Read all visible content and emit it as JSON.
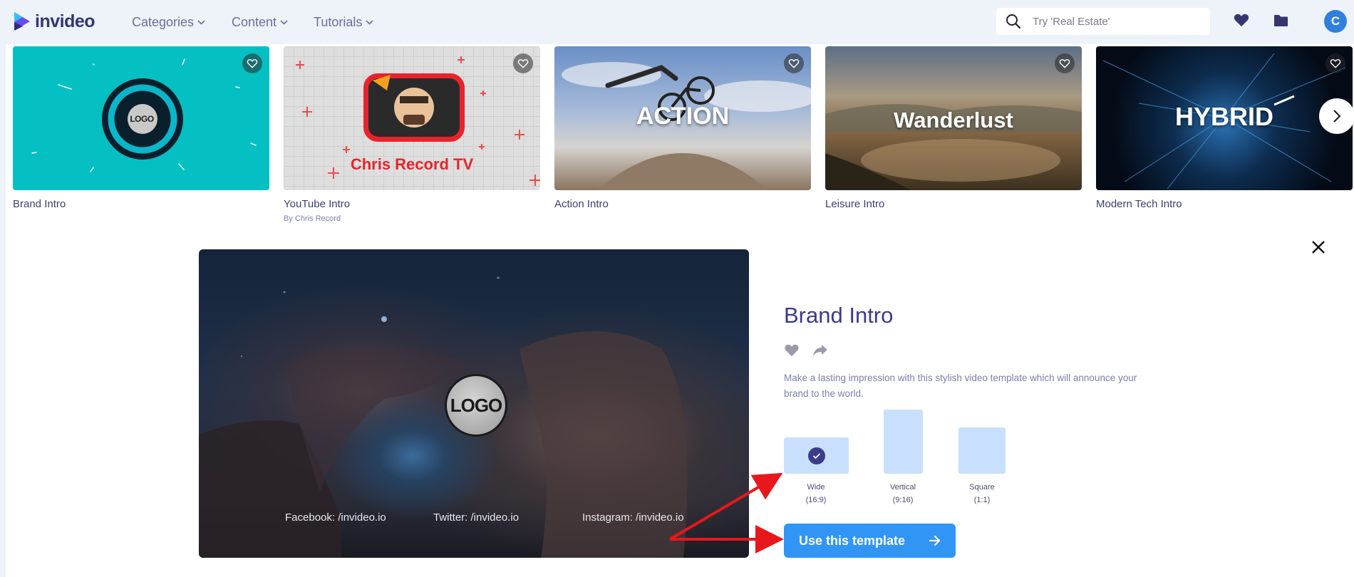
{
  "brand": {
    "name": "invideo"
  },
  "nav": {
    "links": [
      "Categories",
      "Content",
      "Tutorials"
    ],
    "search_placeholder": "Try 'Real Estate'",
    "avatar_initial": "C"
  },
  "cards": [
    {
      "title": "Brand Intro",
      "subtitle": "",
      "thumb_text": "LOGO"
    },
    {
      "title": "YouTube Intro",
      "subtitle": "By Chris Record",
      "thumb_text": "Chris Record TV"
    },
    {
      "title": "Action Intro",
      "subtitle": "",
      "thumb_text": "ACTION"
    },
    {
      "title": "Leisure Intro",
      "subtitle": "",
      "thumb_text": "Wanderlust"
    },
    {
      "title": "Modern Tech Intro",
      "subtitle": "",
      "thumb_text": "HYBRID"
    }
  ],
  "preview": {
    "logo_text": "LOGO",
    "socials": [
      "Facebook: /invideo.io",
      "Twitter: /invideo.io",
      "Instagram: /invideo.io"
    ]
  },
  "template": {
    "title": "Brand Intro",
    "description": "Make a lasting impression with this stylish video template which will announce your brand to the world.",
    "ratios": [
      {
        "label": "Wide",
        "sub": "(16:9)",
        "selected": true
      },
      {
        "label": "Vertical",
        "sub": "(9:16)",
        "selected": false
      },
      {
        "label": "Square",
        "sub": "(1:1)",
        "selected": false
      }
    ],
    "cta": "Use this template"
  },
  "colors": {
    "accent": "#3095f4",
    "brand_text": "#35366f",
    "ratio_fill": "#c8e0fd",
    "annotation": "#e8171b"
  }
}
